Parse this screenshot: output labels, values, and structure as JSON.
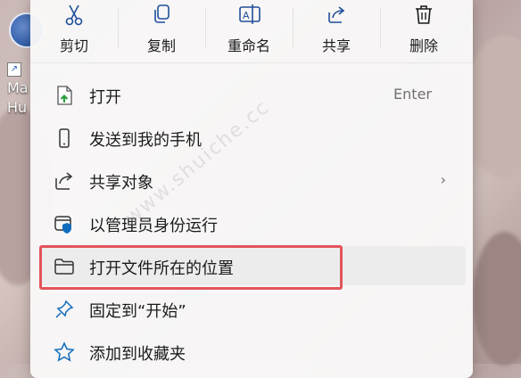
{
  "desktop": {
    "icon_label": "Ma\nHu"
  },
  "watermark": "www.shuiche.cc",
  "toolbar": {
    "cut": "剪切",
    "copy": "复制",
    "rename": "重命名",
    "share": "共享",
    "delete": "删除"
  },
  "menu": {
    "open": {
      "label": "打开",
      "accelerator": "Enter"
    },
    "send_to_phone": {
      "label": "发送到我的手机"
    },
    "share_to": {
      "label": "共享对象"
    },
    "run_as_admin": {
      "label": "以管理员身份运行"
    },
    "open_file_location": {
      "label": "打开文件所在的位置"
    },
    "pin_start": {
      "label": "固定到“开始”"
    },
    "add_favorites": {
      "label": "添加到收藏夹"
    }
  },
  "colors": {
    "highlight_border": "#e2545a",
    "accent_blue": "#0f6cbd",
    "open_green": "#2e9e3f"
  }
}
